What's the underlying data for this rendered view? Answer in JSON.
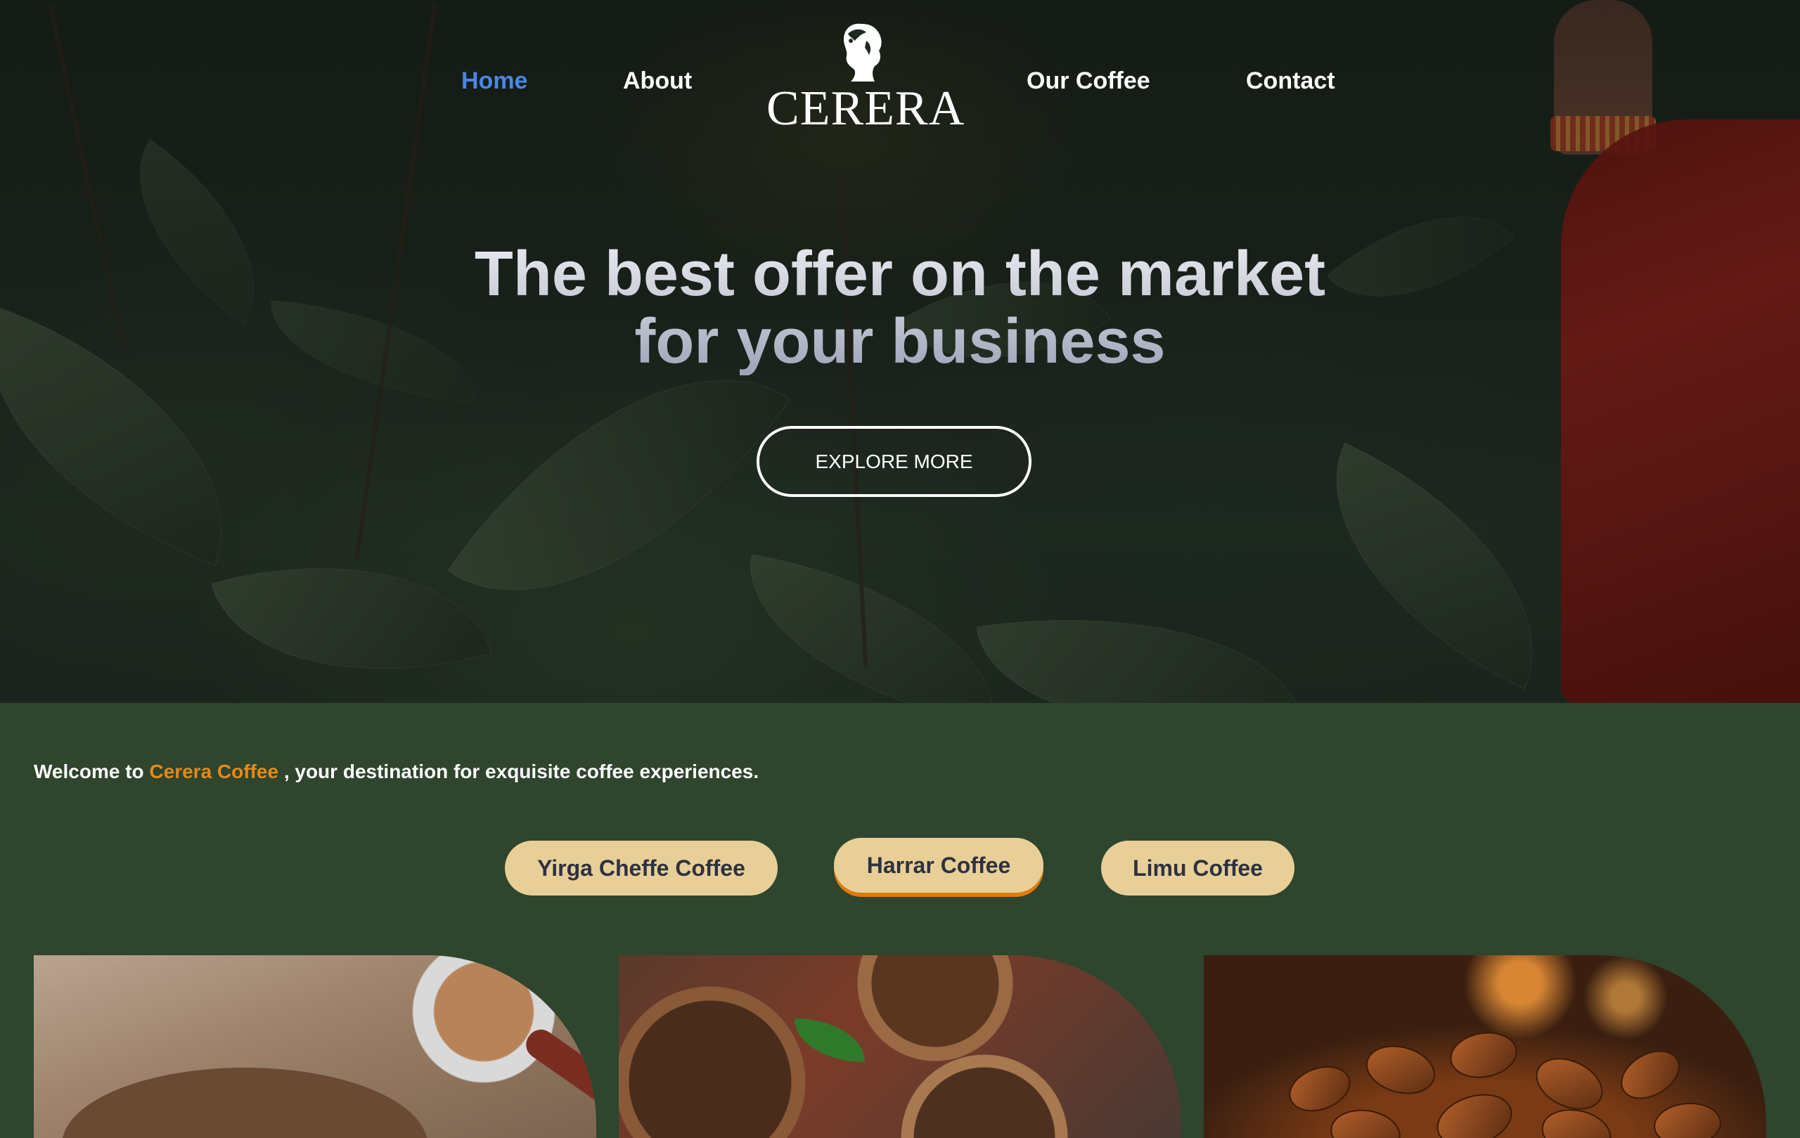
{
  "nav": {
    "home": "Home",
    "about": "About",
    "our_coffee": "Our Coffee",
    "contact": "Contact",
    "logo_text": "CERERA"
  },
  "hero": {
    "title_line1": "The best offer on the market",
    "title_line2": "for your business",
    "cta_label": "EXPLORE MORE"
  },
  "welcome": {
    "prefix": "Welcome to ",
    "brand": "Cerera Coffee",
    "suffix": " , your destination for exquisite coffee experiences."
  },
  "tabs": [
    {
      "label": "Yirga Cheffe Coffee"
    },
    {
      "label": "Harrar Coffee",
      "active": true
    },
    {
      "label": "Limu Coffee"
    }
  ],
  "colors": {
    "page_background": "#2f452d",
    "nav_active": "#4b86e6",
    "brand_accent": "#e58a17",
    "tab_background": "#e8cf98",
    "tab_active_underline": "#e07a0a"
  },
  "images": [
    {
      "name": "coffee-portafilter-image"
    },
    {
      "name": "coffee-beans-bowls-image"
    },
    {
      "name": "roasted-beans-image"
    }
  ]
}
